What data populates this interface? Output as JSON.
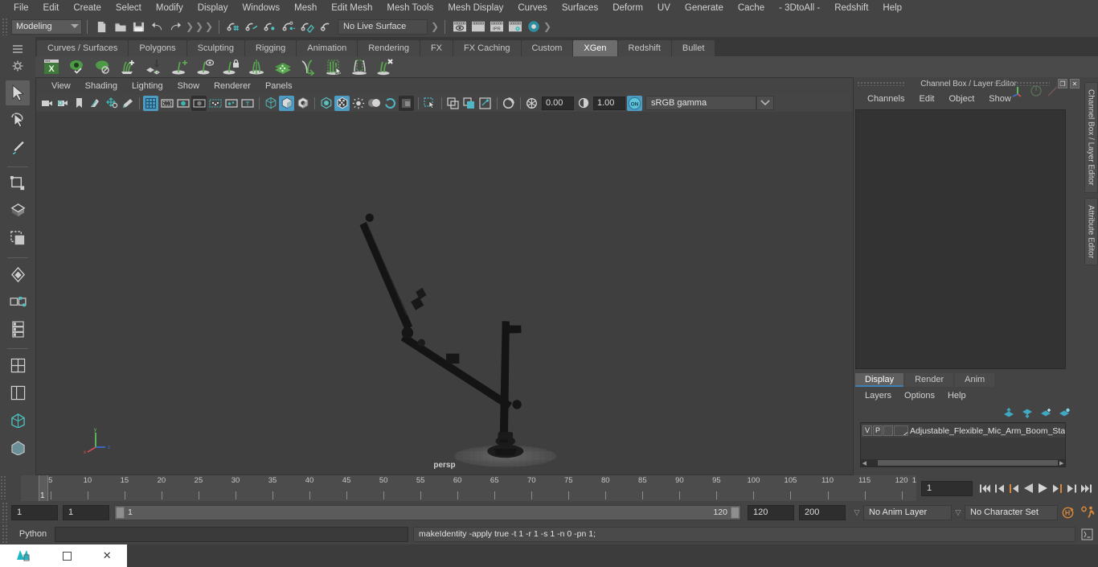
{
  "menubar": {
    "items": [
      "File",
      "Edit",
      "Create",
      "Select",
      "Modify",
      "Display",
      "Windows",
      "Mesh",
      "Edit Mesh",
      "Mesh Tools",
      "Mesh Display",
      "Curves",
      "Surfaces",
      "Deform",
      "UV",
      "Generate",
      "Cache",
      "- 3DtoAll -",
      "Redshift",
      "Help"
    ]
  },
  "statusline": {
    "mode": "Modeling",
    "live_surface": "No Live Surface",
    "icons": [
      "new-scene-icon",
      "open-scene-icon",
      "save-scene-icon",
      "undo-icon",
      "redo-icon",
      "select-by-hierarchy-icon",
      "select-by-object-icon",
      "select-by-component-icon",
      "snap-to-grid-icon",
      "snap-to-curve-icon",
      "snap-to-point-icon",
      "snap-to-projected-center-icon",
      "snap-to-view-plane-icon",
      "make-live-icon",
      "render-view-icon",
      "render-sequence-icon",
      "ipr-render-icon",
      "render-settings-icon",
      "hypershade-icon"
    ]
  },
  "shelf": {
    "tabs": [
      "Curves / Surfaces",
      "Polygons",
      "Sculpting",
      "Rigging",
      "Animation",
      "Rendering",
      "FX",
      "FX Caching",
      "Custom",
      "XGen",
      "Redshift",
      "Bullet"
    ],
    "active_tab": "XGen",
    "items": [
      "xgen-editor-icon",
      "xgen-preview-on-icon",
      "xgen-preview-off-icon",
      "xgen-add-description-icon",
      "xgen-import-collection-icon",
      "xgen-add-guide-icon",
      "xgen-guide-visibility-icon",
      "xgen-freeze-guide-icon",
      "xgen-mirror-guide-icon",
      "xgen-density-map-icon",
      "xgen-move-guide-icon",
      "xgen-select-primitives-icon",
      "xgen-region-mask-icon",
      "xgen-delete-guide-icon"
    ]
  },
  "toolbox": {
    "items": [
      "select-tool",
      "lasso-select-tool",
      "paint-select-tool",
      "move-tool",
      "rotate-tool",
      "scale-tool",
      "soft-modification-tool",
      "show-manipulator-tool",
      "last-tool-used",
      "four-view-layout",
      "persp-outliner-layout",
      "persp-graph-layout",
      "hypershade-persp-layout",
      "single-persp-layout"
    ]
  },
  "viewport": {
    "menus": [
      "View",
      "Shading",
      "Lighting",
      "Show",
      "Renderer",
      "Panels"
    ],
    "camera_label": "persp",
    "toolbar": {
      "exposure": "0.00",
      "gamma": "1.00",
      "color_space": "sRGB gamma",
      "icons": [
        "select-camera-icon",
        "camera-attributes-icon",
        "bookmark-icon",
        "image-plane-icon",
        "2d-pan-zoom-icon",
        "grease-pencil-icon",
        "grid-toggle-icon",
        "film-gate-icon",
        "resolution-gate-icon",
        "gate-mask-icon",
        "film-origin-icon",
        "safe-action-icon",
        "safe-title-icon",
        "wireframe-icon",
        "smooth-shade-all-icon",
        "smooth-shade-textured-icon",
        "use-default-material-icon",
        "shaded-wireframe-icon",
        "textured-icon",
        "lights-icon",
        "shadows-icon",
        "screen-space-ao-icon",
        "motion-blur-icon",
        "multisample-icon",
        "isolate-select-icon",
        "xray-icon",
        "xray-joints-icon",
        "xray-active-components-icon",
        "viewport-refresh-icon",
        "exposure-icon",
        "gamma-icon",
        "color-management-on-icon"
      ]
    },
    "axis": {
      "x": "x",
      "y": "y",
      "z": "z"
    }
  },
  "right_panel": {
    "title": "Channel Box / Layer Editor",
    "window_buttons": [
      "restore-icon",
      "close-icon"
    ],
    "channel_menus": [
      "Channels",
      "Edit",
      "Object",
      "Show"
    ],
    "layer_tabs": [
      "Display",
      "Render",
      "Anim"
    ],
    "layer_active_tab": "Display",
    "layer_menus": [
      "Layers",
      "Options",
      "Help"
    ],
    "layer_icons": [
      "move-layer-up-icon",
      "move-layer-down-icon",
      "new-layer-icon",
      "new-layer-from-selection-icon"
    ],
    "layers": [
      {
        "visibility": "V",
        "playback": "P",
        "extra": "",
        "name": "Adjustable_Flexible_Mic_Arm_Boom_Stand_"
      }
    ],
    "vertical_tabs": [
      "Channel Box / Layer Editor",
      "Attribute Editor"
    ]
  },
  "timeline": {
    "ticks": [
      5,
      10,
      15,
      20,
      25,
      30,
      35,
      40,
      45,
      50,
      55,
      60,
      65,
      70,
      75,
      80,
      85,
      90,
      95,
      100,
      105,
      110,
      115,
      120
    ],
    "current_frame_label": "1",
    "end_label": "12",
    "current_frame_field": "1",
    "playback_buttons": [
      "go-to-start-icon",
      "step-back-keyframe-icon",
      "step-back-frame-icon",
      "play-backwards-icon",
      "play-forwards-icon",
      "step-forward-frame-icon",
      "step-forward-keyframe-icon",
      "go-to-end-icon"
    ]
  },
  "range": {
    "start_field": "1",
    "playback_start_field": "1",
    "slider_start_label": "1",
    "slider_end_label": "120",
    "playback_end_field": "120",
    "end_field": "200",
    "anim_layer": "No Anim Layer",
    "character_set": "No Character Set",
    "icons": [
      "auto-keyframe-icon",
      "animation-preferences-icon"
    ]
  },
  "command_line": {
    "language": "Python",
    "input_value": "",
    "output": "makeIdentity -apply true -t 1 -r 1 -s 1 -n 0 -pn 1;",
    "script_editor_icon": "script-editor-icon"
  },
  "taskbar": {
    "app_icon": "maya-app-icon",
    "restore_icon": "restore-window-icon",
    "minimize_icon": "minimize-window-icon",
    "close_icon": "close-window-icon"
  },
  "colors": {
    "accent": "#4d9cc4",
    "shelf_green": "#5aa84f",
    "background": "#444444",
    "viewport": "#3f3f3f",
    "orange": "#d8873a"
  }
}
